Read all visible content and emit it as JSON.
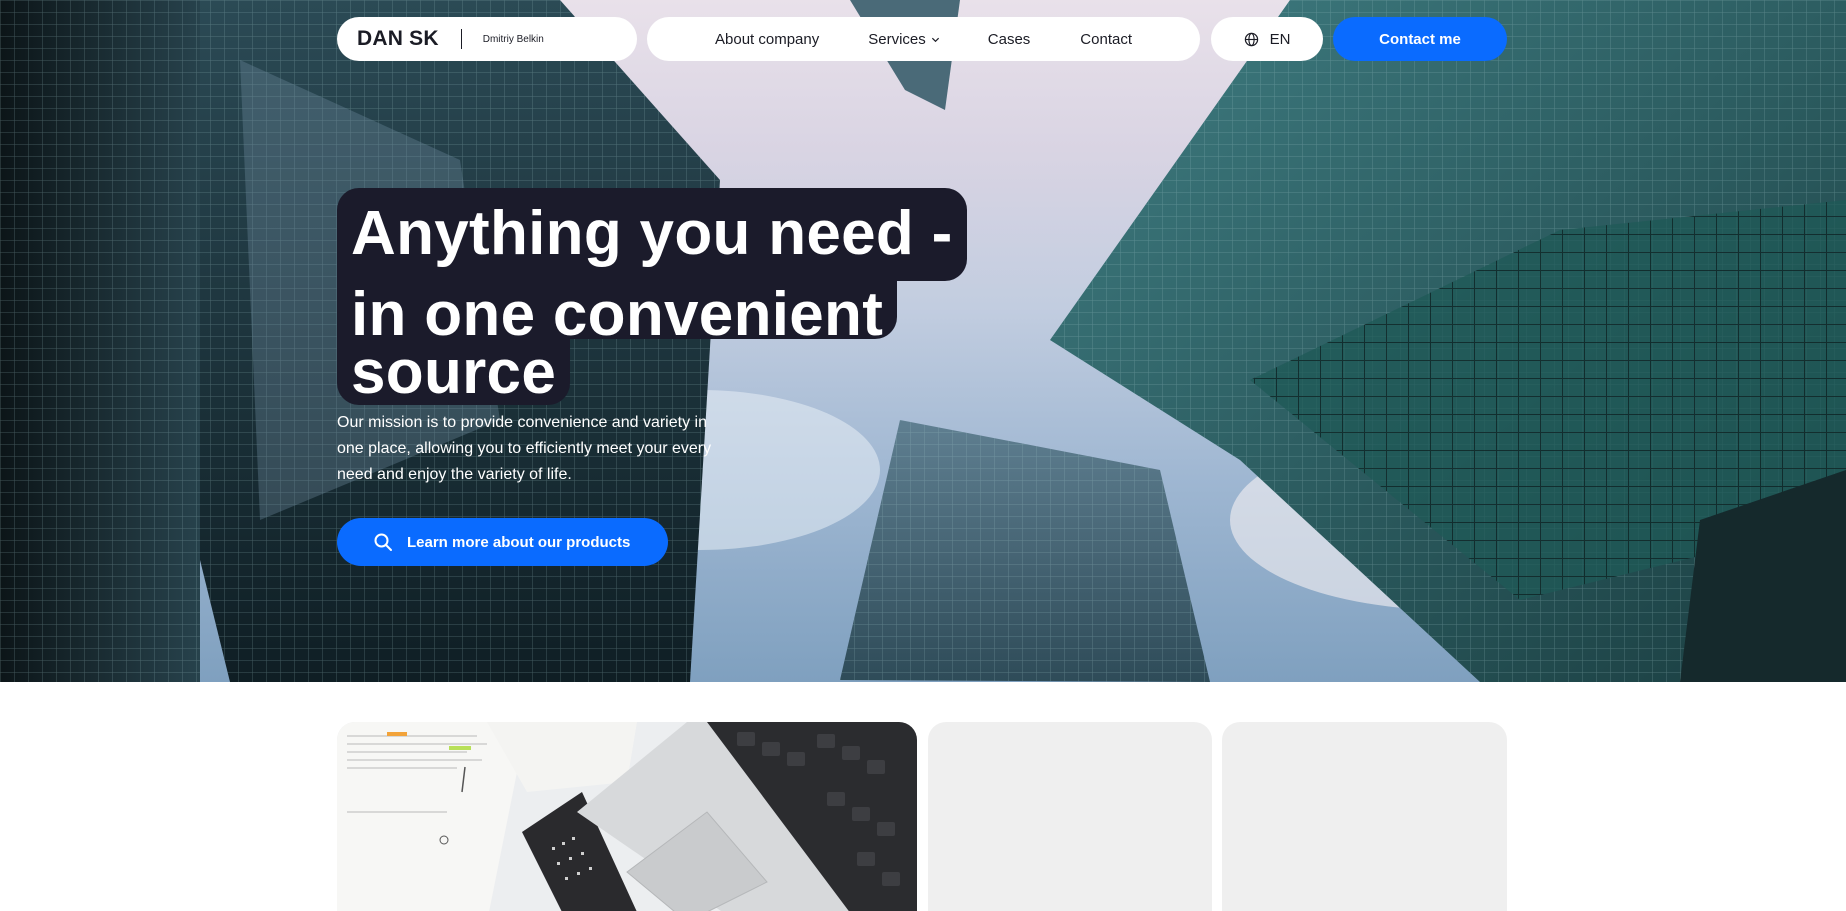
{
  "header": {
    "brand": {
      "name": "DAN SK",
      "person": "Dmitriy Belkin"
    },
    "nav": [
      {
        "label": "About company"
      },
      {
        "label": "Services",
        "icon": "chevron-down-icon"
      },
      {
        "label": "Cases"
      },
      {
        "label": "Contact"
      }
    ],
    "language": {
      "label": "EN",
      "icon": "globe-icon"
    },
    "contact_button": "Contact me"
  },
  "hero": {
    "headline": [
      "Anything you need -",
      "in one convenient",
      "source"
    ],
    "mission": "Our mission is to provide convenience and variety in one place, allowing you to efficiently meet your every need and enjoy the variety of life.",
    "learn_button": {
      "label": "Learn more about our products",
      "icon": "search-icon"
    },
    "background": "skyscrapers-photo"
  },
  "cards": [
    {
      "image": "laptop-calendar-photo"
    },
    {
      "image": "empty-placeholder"
    },
    {
      "image": "empty-placeholder"
    }
  ],
  "colors": {
    "accent": "#0a6bff",
    "headline_bg": "#1b1b2b",
    "card_placeholder": "#efefef"
  }
}
